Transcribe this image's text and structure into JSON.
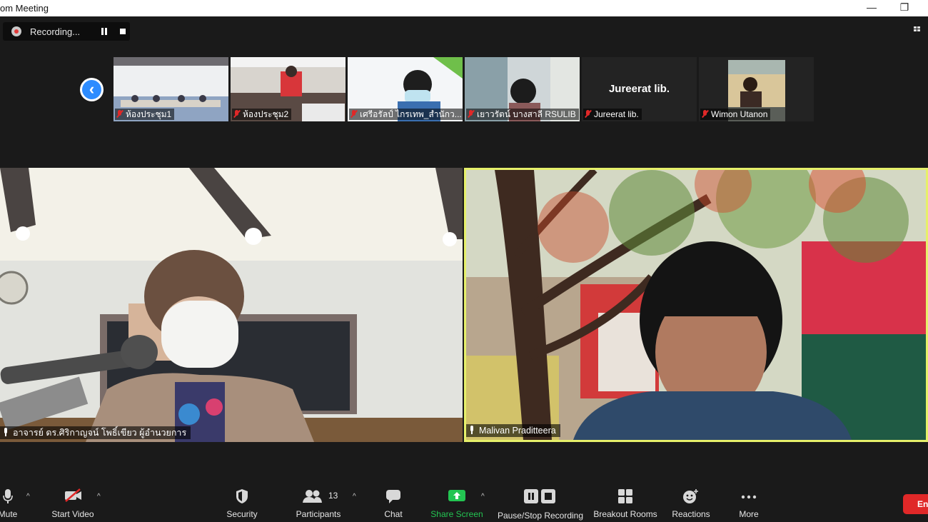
{
  "window": {
    "title": "om Meeting",
    "minimize_glyph": "—",
    "restore_glyph": "❐"
  },
  "recording": {
    "label": "Recording..."
  },
  "thumbnails": [
    {
      "name": "ห้องประชุม1",
      "muted": true
    },
    {
      "name": "ห้องประชุม2",
      "muted": true
    },
    {
      "name": "เศรีอรัลป์ ไกรเทพ_สำนักว...",
      "muted": true
    },
    {
      "name": "เยาวรัตน์ บางสาลี RSULIB",
      "muted": true
    },
    {
      "name": "Jureerat lib.",
      "muted": true,
      "display_name": "Jureerat lib."
    },
    {
      "name": "Wimon Utanon",
      "muted": true
    }
  ],
  "main_tiles": {
    "left": {
      "name": "อาจารย์ ดร.ศิริกาญจน์ โพธิ์เขียว ผู้อำนวยการ"
    },
    "right": {
      "name": "Malivan Praditteera",
      "active_speaker_color": "#e6f06a"
    }
  },
  "toolbar": {
    "mute": "Mute",
    "start_video": "Start Video",
    "security": "Security",
    "participants": "Participants",
    "participants_count": "13",
    "chat": "Chat",
    "share_screen": "Share Screen",
    "pause_stop_recording": "Pause/Stop Recording",
    "breakout_rooms": "Breakout Rooms",
    "reactions": "Reactions",
    "more": "More",
    "end": "End"
  },
  "colors": {
    "accent": "#2d8cff",
    "share": "#23c552",
    "end": "#e02828",
    "muted": "#e02828"
  }
}
